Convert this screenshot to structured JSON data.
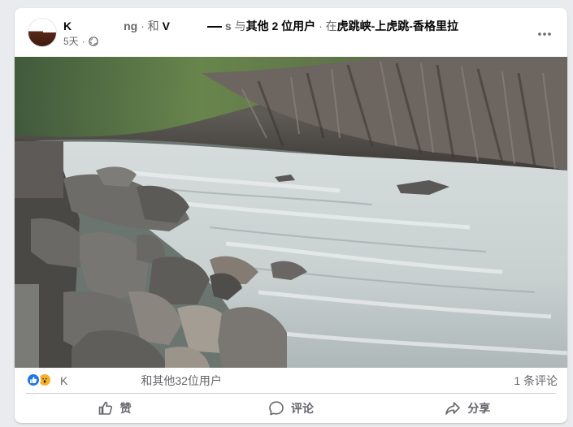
{
  "post": {
    "author_visible": "K",
    "author_suffix": "ng",
    "conjunction": "· 和",
    "tagged_visible": "V",
    "tagged_suffix": "s",
    "with_others_prefix": "与",
    "with_others": "其他 2 位用户",
    "location_prefix": "· 在",
    "location": "虎跳峡-上虎跳-香格里拉",
    "time": "5天",
    "time_separator": "·",
    "privacy_icon": "globe-icon",
    "more_icon": "more-horizontal-icon"
  },
  "photo": {
    "subject": "river-gorge-photo"
  },
  "stats": {
    "reactions": [
      "like-reaction-icon",
      "wow-reaction-icon"
    ],
    "reactor_visible": "K",
    "reactor_suffix": "和其他32位用户",
    "comments": "1 条评论"
  },
  "actions": {
    "like": "赞",
    "comment": "评论",
    "share": "分享"
  },
  "colors": {
    "like_blue": "#1877f2",
    "wow_yellow": "#f7b125",
    "secondary_text": "#65676b"
  }
}
